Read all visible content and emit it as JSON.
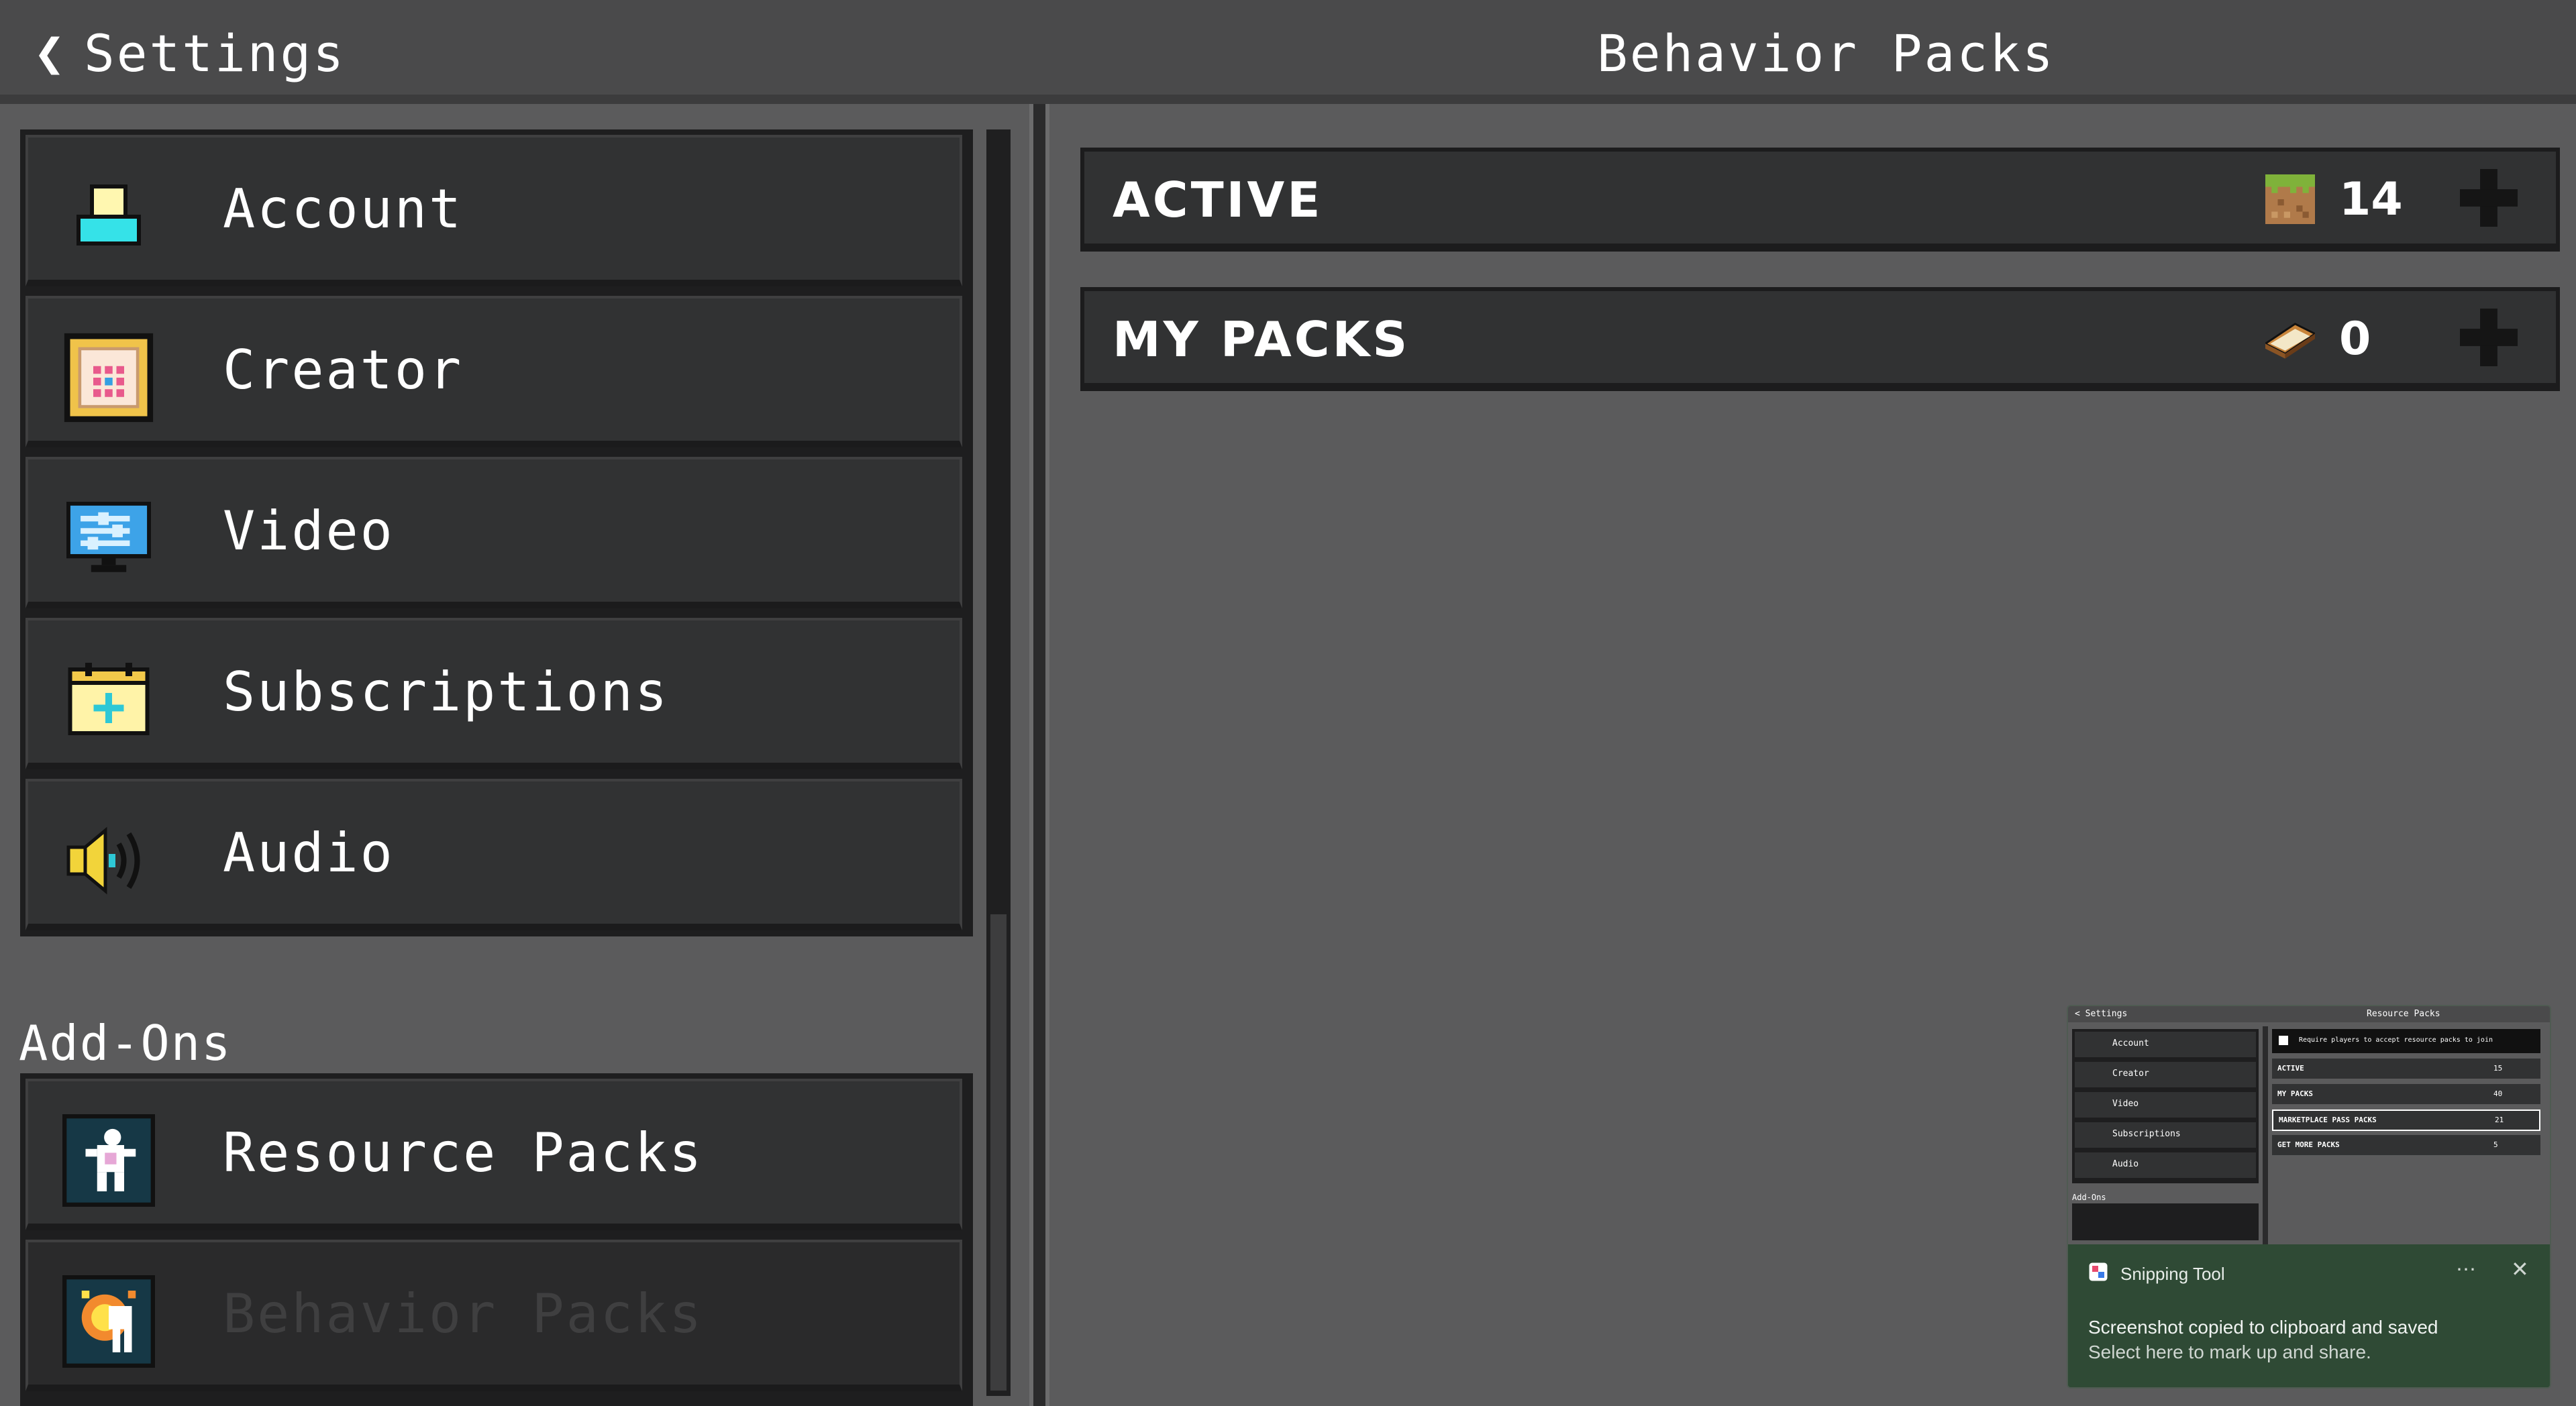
{
  "header": {
    "back_icon": "chevron-left-icon",
    "back_label": "Settings",
    "title": "Behavior Packs"
  },
  "sidebar": {
    "items": [
      {
        "label": "Account",
        "icon": "account-icon"
      },
      {
        "label": "Creator",
        "icon": "creator-icon"
      },
      {
        "label": "Video",
        "icon": "monitor-icon"
      },
      {
        "label": "Subscriptions",
        "icon": "subscriptions-icon"
      },
      {
        "label": "Audio",
        "icon": "speaker-icon"
      }
    ],
    "section_label": "Add-Ons",
    "addons": [
      {
        "label": "Resource Packs",
        "icon": "resource-pack-icon"
      },
      {
        "label": "Behavior Packs",
        "icon": "behavior-pack-icon",
        "selected": true
      }
    ]
  },
  "packs": {
    "active": {
      "label": "ACTIVE",
      "count": "14",
      "icon": "grass-block-icon"
    },
    "my_packs": {
      "label": "MY PACKS",
      "count": "0",
      "icon": "book-icon"
    }
  },
  "toast": {
    "app_name": "Snipping Tool",
    "message": "Screenshot copied to clipboard and saved",
    "sub_message": "Select here to mark up and share.",
    "more_icon": "⋯",
    "close_icon": "✕",
    "thumbnail": {
      "back_label": "< Settings",
      "title": "Resource Packs",
      "items": [
        "Account",
        "Creator",
        "Video",
        "Subscriptions",
        "Audio"
      ],
      "section_label": "Add-Ons",
      "checkbox_label": "Require players to accept resource packs to join",
      "rows": [
        {
          "label": "ACTIVE",
          "count": "15"
        },
        {
          "label": "MY PACKS",
          "count": "40"
        },
        {
          "label": "MARKETPLACE PASS PACKS",
          "count": "21"
        },
        {
          "label": "GET MORE PACKS",
          "count": "5"
        }
      ]
    }
  },
  "colors": {
    "background": "#5b5b5c",
    "header": "#4a4a4b",
    "panel": "#313233",
    "toast": "#2f4a35",
    "accent_cyan": "#35e2e8"
  }
}
